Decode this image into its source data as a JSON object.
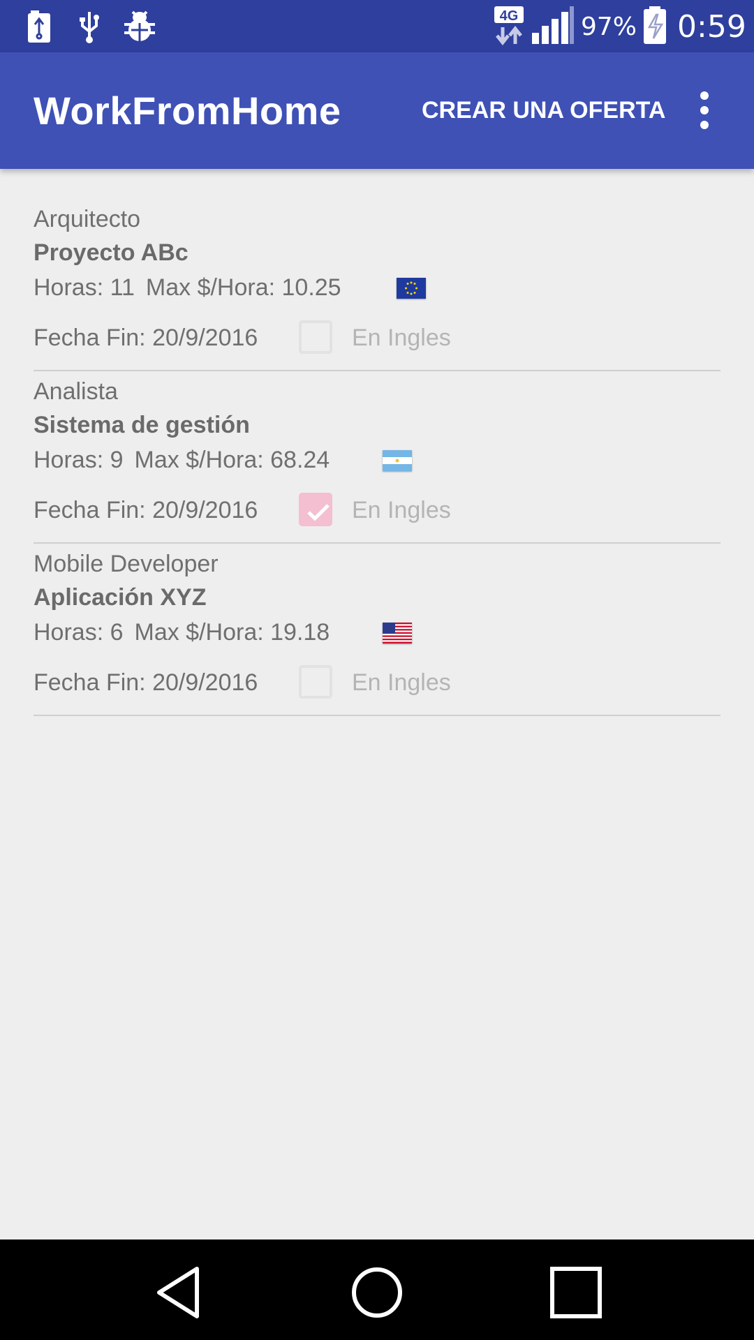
{
  "status_bar": {
    "network": "4G",
    "battery_percent": "97%",
    "time": "0:59",
    "left_icons": [
      "battery-usb-icon",
      "usb-icon",
      "bug-icon"
    ],
    "right_icons": [
      "network-4g-icon",
      "signal-icon",
      "battery-charging-icon"
    ]
  },
  "app_bar": {
    "title": "WorkFromHome",
    "action_label": "CREAR UNA OFERTA",
    "overflow_icon": "more-vert-icon",
    "color": "#3f51b5"
  },
  "offers": [
    {
      "role": "Arquitecto",
      "project": "Proyecto ABc",
      "hours": "Horas: 11",
      "max_rate": "Max $/Hora: 10.25",
      "flag": "eu-flag-icon",
      "end_date": "Fecha Fin: 20/9/2016",
      "english_label": "En Ingles",
      "english_checked": false
    },
    {
      "role": "Analista",
      "project": "Sistema de gestión",
      "hours": "Horas: 9",
      "max_rate": "Max $/Hora: 68.24",
      "flag": "argentina-flag-icon",
      "end_date": "Fecha Fin: 20/9/2016",
      "english_label": "En Ingles",
      "english_checked": true
    },
    {
      "role": "Mobile Developer",
      "project": "Aplicación XYZ",
      "hours": "Horas: 6",
      "max_rate": "Max $/Hora: 19.18",
      "flag": "usa-flag-icon",
      "end_date": "Fecha Fin: 20/9/2016",
      "english_label": "En Ingles",
      "english_checked": false
    }
  ],
  "nav_bar": {
    "buttons": [
      "back-icon",
      "home-icon",
      "recents-icon"
    ]
  },
  "colors": {
    "status_bar": "#2f3f9e",
    "accent_checked": "#f4bfd0",
    "background": "#eeeeee"
  }
}
